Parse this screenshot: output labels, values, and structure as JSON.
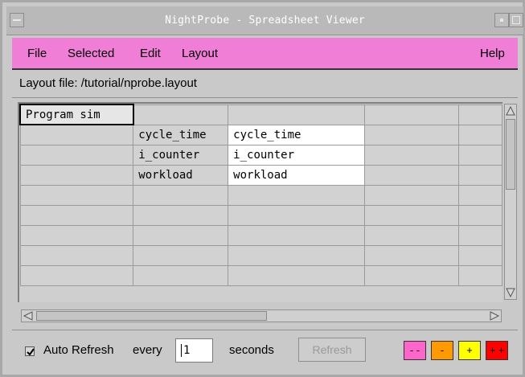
{
  "window": {
    "title": "NightProbe - Spreadsheet Viewer"
  },
  "menu": {
    "file": "File",
    "selected": "Selected",
    "edit": "Edit",
    "layout": "Layout",
    "help": "Help"
  },
  "layout_file": "Layout file: /tutorial/nprobe.layout",
  "sheet": {
    "title": "Program sim",
    "rows": [
      {
        "label": "cycle_time",
        "value": "cycle_time"
      },
      {
        "label": "i_counter",
        "value": "i_counter"
      },
      {
        "label": "workload",
        "value": "workload"
      }
    ]
  },
  "bottom": {
    "auto_refresh_label": "Auto Refresh",
    "every_label": "every",
    "interval_value": "1",
    "seconds_label": "seconds",
    "refresh_label": "Refresh",
    "speed_buttons": [
      {
        "label": "- -",
        "color": "#ff66cc"
      },
      {
        "label": "-",
        "color": "#ff9900"
      },
      {
        "label": "+",
        "color": "#ffff00"
      },
      {
        "label": "+ +",
        "color": "#ff0000"
      }
    ]
  }
}
